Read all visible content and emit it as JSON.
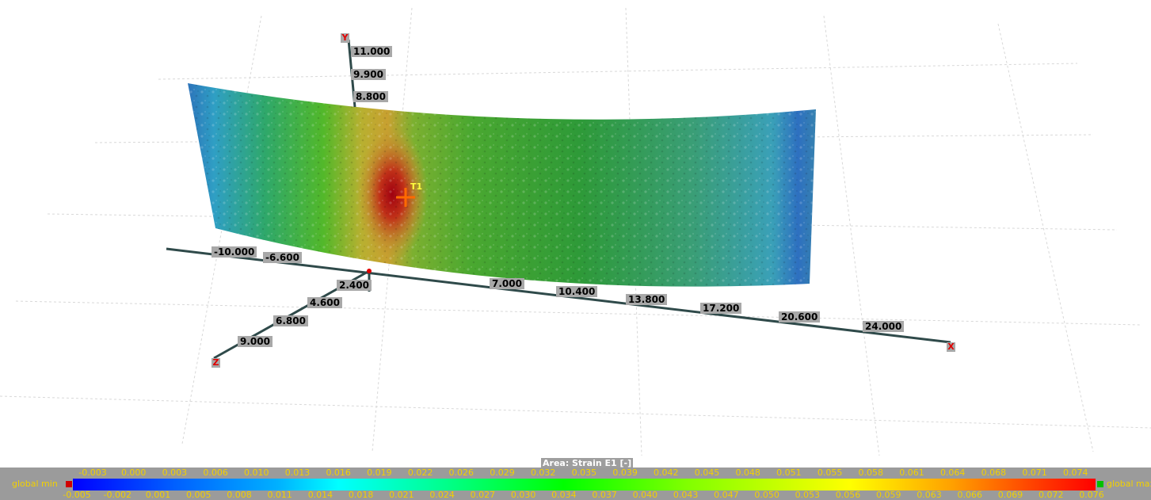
{
  "viewer": {
    "axes": {
      "y_letter": "Y",
      "x_letter": "X",
      "z_letter": "Z",
      "y_ticks": [
        "11.000",
        "9.900",
        "8.800"
      ],
      "x_ticks": [
        "-10.000",
        "-6.600",
        "7.000",
        "10.400",
        "13.800",
        "17.200",
        "20.600",
        "24.000"
      ],
      "z_ticks": [
        "2.400",
        "4.600",
        "6.800",
        "9.000"
      ]
    },
    "marker": {
      "label": "T1",
      "color": "#ff6a00"
    }
  },
  "legend": {
    "title": "Area: Strain E1 [-]",
    "min_label": "global min",
    "max_label": "global max",
    "min_color": "#d00000",
    "max_color": "#00c000",
    "label_color": "#f2d000",
    "top_ticks": [
      "-0.003",
      "0.000",
      "0.003",
      "0.006",
      "0.010",
      "0.013",
      "0.016",
      "0.019",
      "0.022",
      "0.026",
      "0.029",
      "0.032",
      "0.035",
      "0.039",
      "0.042",
      "0.045",
      "0.048",
      "0.051",
      "0.055",
      "0.058",
      "0.061",
      "0.064",
      "0.068",
      "0.071",
      "0.074"
    ],
    "bottom_ticks": [
      "-0.005",
      "-0.002",
      "0.001",
      "0.005",
      "0.008",
      "0.011",
      "0.014",
      "0.018",
      "0.021",
      "0.024",
      "0.027",
      "0.030",
      "0.034",
      "0.037",
      "0.040",
      "0.043",
      "0.047",
      "0.050",
      "0.053",
      "0.056",
      "0.059",
      "0.063",
      "0.066",
      "0.069",
      "0.072",
      "0.076"
    ]
  }
}
